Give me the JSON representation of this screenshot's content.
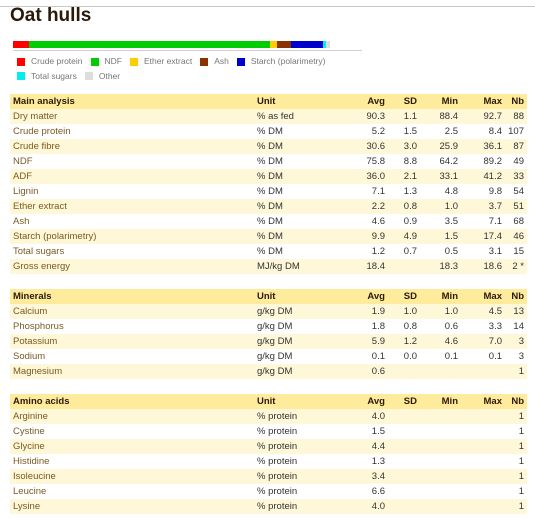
{
  "title": "Oat hulls",
  "composition": [
    {
      "label": "Crude protein",
      "color": "#ff0000",
      "percent": 5.2
    },
    {
      "label": "NDF",
      "color": "#00cc00",
      "percent": 75.8
    },
    {
      "label": "Ether extract",
      "color": "#ffcc00",
      "percent": 2.2
    },
    {
      "label": "Ash",
      "color": "#883300",
      "percent": 4.6
    },
    {
      "label": "Starch (polarimetry)",
      "color": "#0000cc",
      "percent": 9.9
    },
    {
      "label": "Total sugars",
      "color": "#00eeee",
      "percent": 1.2
    },
    {
      "label": "Other",
      "color": "#dddddd",
      "percent": 1.1
    }
  ],
  "columns": [
    "Unit",
    "Avg",
    "SD",
    "Min",
    "Max",
    "Nb"
  ],
  "tables": [
    {
      "title": "Main analysis",
      "rows": [
        [
          "Dry matter",
          "% as fed",
          "90.3",
          "1.1",
          "88.4",
          "92.7",
          "88"
        ],
        [
          "Crude protein",
          "% DM",
          "5.2",
          "1.5",
          "2.5",
          "8.4",
          "107"
        ],
        [
          "Crude fibre",
          "% DM",
          "30.6",
          "3.0",
          "25.9",
          "36.1",
          "87"
        ],
        [
          "NDF",
          "% DM",
          "75.8",
          "8.8",
          "64.2",
          "89.2",
          "49"
        ],
        [
          "ADF",
          "% DM",
          "36.0",
          "2.1",
          "33.1",
          "41.2",
          "33"
        ],
        [
          "Lignin",
          "% DM",
          "7.1",
          "1.3",
          "4.8",
          "9.8",
          "54"
        ],
        [
          "Ether extract",
          "% DM",
          "2.2",
          "0.8",
          "1.0",
          "3.7",
          "51"
        ],
        [
          "Ash",
          "% DM",
          "4.6",
          "0.9",
          "3.5",
          "7.1",
          "68"
        ],
        [
          "Starch (polarimetry)",
          "% DM",
          "9.9",
          "4.9",
          "1.5",
          "17.4",
          "46"
        ],
        [
          "Total sugars",
          "% DM",
          "1.2",
          "0.7",
          "0.5",
          "3.1",
          "15"
        ],
        [
          "Gross energy",
          "MJ/kg DM",
          "18.4",
          "",
          "18.3",
          "18.6",
          "2 *"
        ]
      ]
    },
    {
      "title": "Minerals",
      "rows": [
        [
          "Calcium",
          "g/kg DM",
          "1.9",
          "1.0",
          "1.0",
          "4.5",
          "13"
        ],
        [
          "Phosphorus",
          "g/kg DM",
          "1.8",
          "0.8",
          "0.6",
          "3.3",
          "14"
        ],
        [
          "Potassium",
          "g/kg DM",
          "5.9",
          "1.2",
          "4.6",
          "7.0",
          "3"
        ],
        [
          "Sodium",
          "g/kg DM",
          "0.1",
          "0.0",
          "0.1",
          "0.1",
          "3"
        ],
        [
          "Magnesium",
          "g/kg DM",
          "0.6",
          "",
          "",
          "",
          "1"
        ]
      ]
    },
    {
      "title": "Amino acids",
      "rows": [
        [
          "Arginine",
          "% protein",
          "4.0",
          "",
          "",
          "",
          "1"
        ],
        [
          "Cystine",
          "% protein",
          "1.5",
          "",
          "",
          "",
          "1"
        ],
        [
          "Glycine",
          "% protein",
          "4.4",
          "",
          "",
          "",
          "1"
        ],
        [
          "Histidine",
          "% protein",
          "1.3",
          "",
          "",
          "",
          "1"
        ],
        [
          "Isoleucine",
          "% protein",
          "3.4",
          "",
          "",
          "",
          "1"
        ],
        [
          "Leucine",
          "% protein",
          "6.6",
          "",
          "",
          "",
          "1"
        ],
        [
          "Lysine",
          "% protein",
          "4.0",
          "",
          "",
          "",
          "1"
        ]
      ]
    }
  ]
}
